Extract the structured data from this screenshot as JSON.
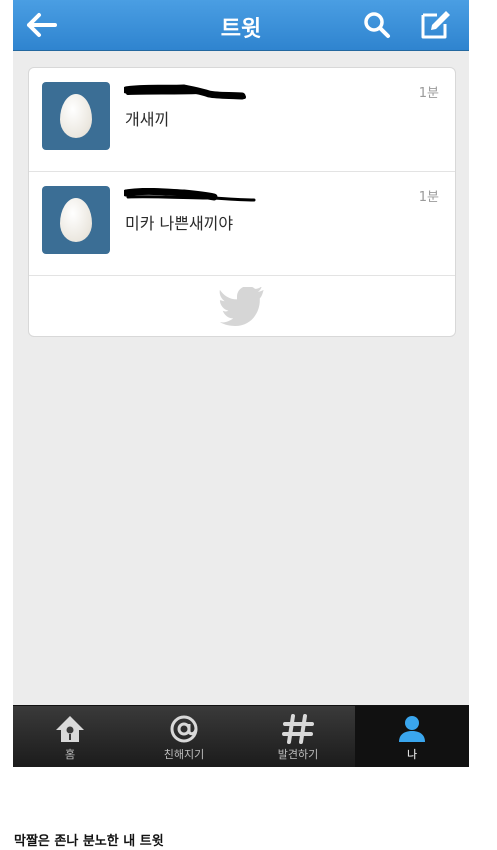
{
  "header": {
    "title": "트윗"
  },
  "tweets": [
    {
      "text": "개새끼",
      "time": "1분"
    },
    {
      "text": "미카 나쁜새끼야",
      "time": "1분"
    }
  ],
  "tabs": [
    {
      "label": "홈"
    },
    {
      "label": "친해지기"
    },
    {
      "label": "발견하기"
    },
    {
      "label": "나"
    }
  ],
  "caption": "막짤은 존나 분노한 내 트윗",
  "colors": {
    "header": "#2f84cf",
    "accent": "#4a9ee3",
    "tabbar": "#1b1b1b"
  }
}
